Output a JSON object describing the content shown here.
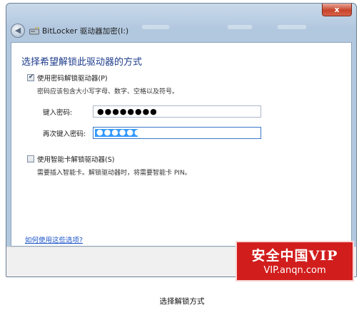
{
  "window": {
    "title": "BitLocker 驱动器加密(I:)",
    "close_glyph": "x"
  },
  "dialog": {
    "heading": "选择希望解锁此驱动器的方式",
    "password_option": {
      "label": "使用密码解锁驱动器(P)",
      "checked": true,
      "hint": "密码应该包含大小写字母、数字、空格以及符号。",
      "enter_label": "键入密码:",
      "enter_value": "●●●●●●●●",
      "reenter_label": "再次键入密码:",
      "reenter_value": "●●●●●●●●"
    },
    "smartcard_option": {
      "label": "使用智能卡解锁驱动器(S)",
      "checked": false,
      "hint": "需要插入智能卡。解锁驱动器时，将需要智能卡 PIN。"
    },
    "help_link": "如何使用这些选项?"
  },
  "watermark": {
    "main": "安全中国VIP",
    "sub": "VIP.anqn.com"
  },
  "caption": "选择解锁方式"
}
